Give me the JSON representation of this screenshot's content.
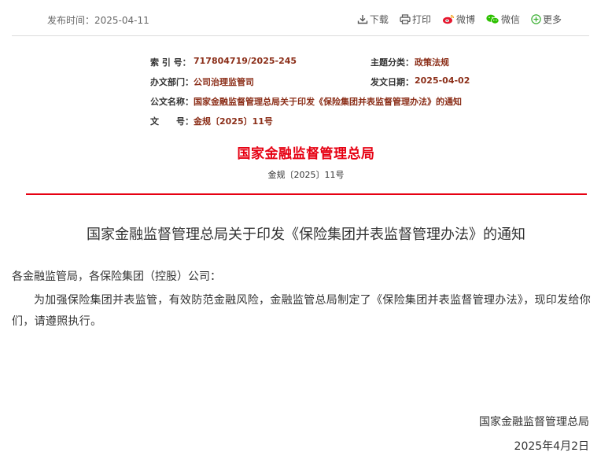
{
  "header": {
    "publish_date_label": "发布时间：",
    "publish_date": "2025-04-11",
    "tools": {
      "download": "下载",
      "print": "打印",
      "weibo": "微博",
      "wechat": "微信",
      "more": "更多"
    }
  },
  "meta": {
    "index_label": "索 引 号：",
    "index_value": "717804719/2025-245",
    "category_label": "主题分类：",
    "category_value": "政策法规",
    "dept_label": "办文部门：",
    "dept_value": "公司治理监管司",
    "date_label": "发文日期：",
    "date_value": "2025-04-02",
    "docname_label": "公文名称：",
    "docname_value": "国家金融监督管理总局关于印发《保险集团并表监督管理办法》的通知",
    "docno_label": "文　　号：",
    "docno_value": "金规〔2025〕11号"
  },
  "document": {
    "issuer": "国家金融监督管理总局",
    "doc_number": "金规〔2025〕11号",
    "title": "国家金融监督管理总局关于印发《保险集团并表监督管理办法》的通知",
    "salutation": "各金融监管局，各保险集团（控股）公司：",
    "body": "为加强保险集团并表监管，有效防范金融风险，金融监管总局制定了《保险集团并表监督管理办法》，现印发给你们，请遵照执行。",
    "signature": "国家金融监督管理总局",
    "sign_date": "2025年4月2日"
  },
  "colors": {
    "accent_red": "#e60012",
    "meta_value": "#8b2e18",
    "more_green": "#3cb034"
  }
}
